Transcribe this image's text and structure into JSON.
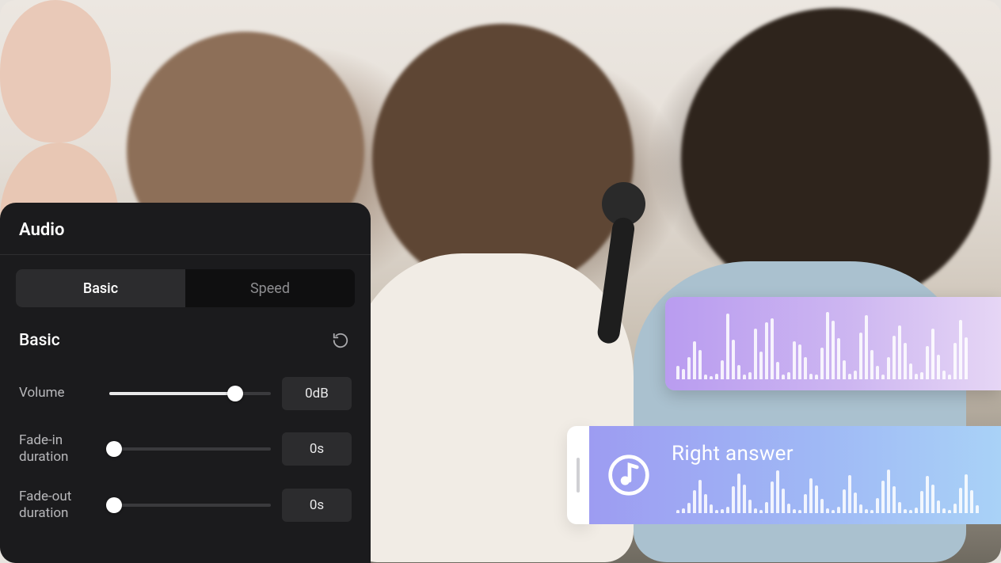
{
  "panel": {
    "title": "Audio",
    "tabs": {
      "basic": "Basic",
      "speed": "Speed",
      "active": "basic"
    },
    "section_title": "Basic",
    "controls": {
      "volume": {
        "label": "Volume",
        "value": "0dB",
        "percent": 78
      },
      "fade_in": {
        "label": "Fade-in duration",
        "value": "0s",
        "percent": 3
      },
      "fade_out": {
        "label": "Fade-out duration",
        "value": "0s",
        "percent": 3
      }
    }
  },
  "clips": {
    "blue_title": "Right answer",
    "purple_wave": [
      18,
      14,
      30,
      52,
      40,
      6,
      4,
      8,
      26,
      90,
      54,
      20,
      6,
      10,
      70,
      38,
      78,
      84,
      24,
      6,
      10,
      52,
      48,
      30,
      8,
      6,
      44,
      92,
      80,
      56,
      26,
      8,
      12,
      64,
      88,
      40,
      18,
      6,
      30,
      60,
      74,
      50,
      22,
      8,
      10,
      46,
      70,
      34,
      12,
      6,
      50,
      82,
      58
    ],
    "blue_wave": [
      6,
      10,
      22,
      48,
      70,
      40,
      18,
      6,
      8,
      14,
      56,
      84,
      60,
      28,
      10,
      6,
      24,
      66,
      90,
      52,
      20,
      8,
      6,
      40,
      74,
      58,
      30,
      10,
      6,
      14,
      50,
      80,
      44,
      18,
      8,
      6,
      32,
      68,
      92,
      56,
      24,
      8,
      6,
      12,
      46,
      78,
      60,
      26,
      10,
      6,
      20,
      54,
      82,
      48,
      16
    ]
  },
  "icons": {
    "reset": "reset-icon",
    "music_note": "music-note-icon"
  }
}
